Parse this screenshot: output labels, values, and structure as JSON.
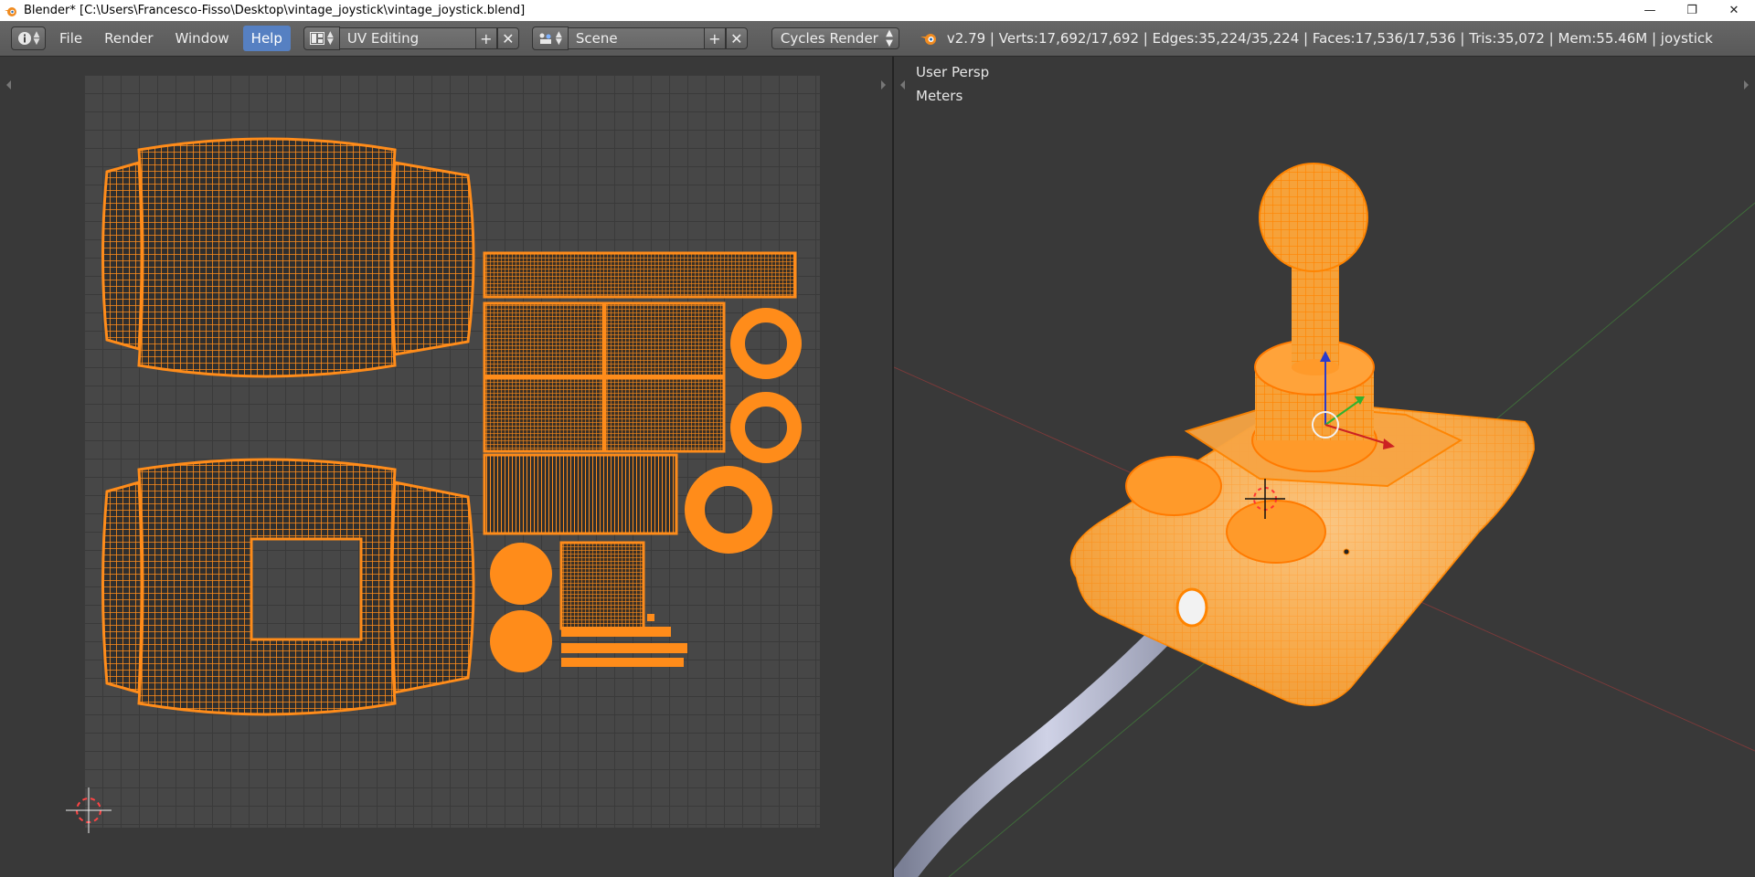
{
  "window": {
    "title": "Blender* [C:\\Users\\Francesco-Fisso\\Desktop\\vintage_joystick\\vintage_joystick.blend]",
    "minimize": "—",
    "maximize": "❐",
    "close": "✕"
  },
  "menu": {
    "file": "File",
    "render": "Render",
    "window": "Window",
    "help": "Help"
  },
  "layout": {
    "screen": "UV Editing"
  },
  "scene": {
    "name": "Scene"
  },
  "engine": {
    "name": "Cycles Render"
  },
  "stats": {
    "text": "v2.79 | Verts:17,692/17,692 | Edges:35,224/35,224 | Faces:17,536/17,536 | Tris:35,072 | Mem:55.46M | joystick"
  },
  "viewport": {
    "view": "User Persp",
    "units": "Meters"
  },
  "colors": {
    "accent": "#ff8c1a",
    "header": "#5f5f5f",
    "active_menu": "#5680c2",
    "background": "#393939"
  },
  "icons": [
    "blender-logo-icon",
    "info-icon",
    "screen-layout-icon",
    "scene-icon",
    "add-icon",
    "remove-icon",
    "cursor-icon"
  ]
}
